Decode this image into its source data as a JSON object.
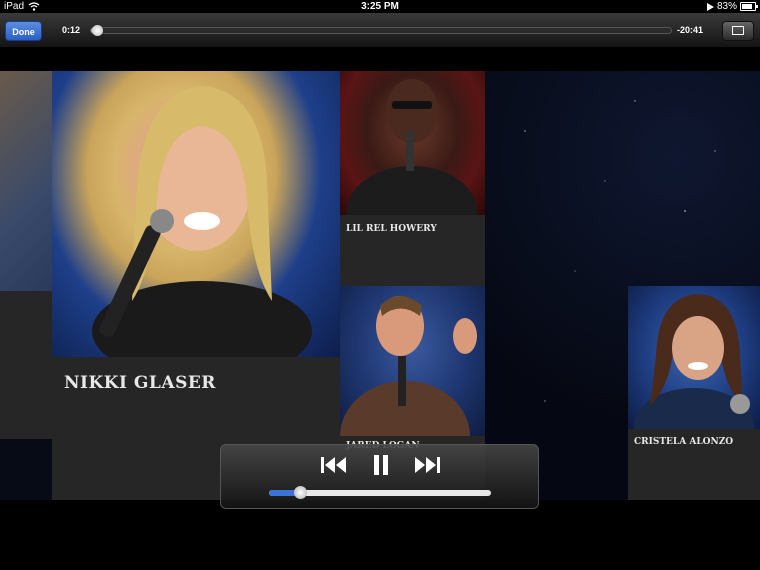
{
  "status_bar": {
    "device": "iPad",
    "time": "3:25 PM",
    "battery_percent": "83%"
  },
  "player": {
    "done_label": "Done",
    "elapsed": "0:12",
    "remaining": "-20:41",
    "playback_progress": 0.01,
    "volume_level": 0.14
  },
  "comedians": [
    {
      "name": "NIKKI GLASER"
    },
    {
      "name": "LIL REL HOWERY"
    },
    {
      "name": "JARED LOGAN"
    },
    {
      "name": "CRISTELA ALONZO"
    }
  ],
  "colors": {
    "accent": "#3a73d8",
    "done_button": "#2a5fc8",
    "card_background": "#262626"
  },
  "icons": [
    "wifi-icon",
    "play-indicator-icon",
    "battery-icon",
    "aspect-ratio-icon",
    "previous-track-icon",
    "pause-icon",
    "next-track-icon"
  ]
}
